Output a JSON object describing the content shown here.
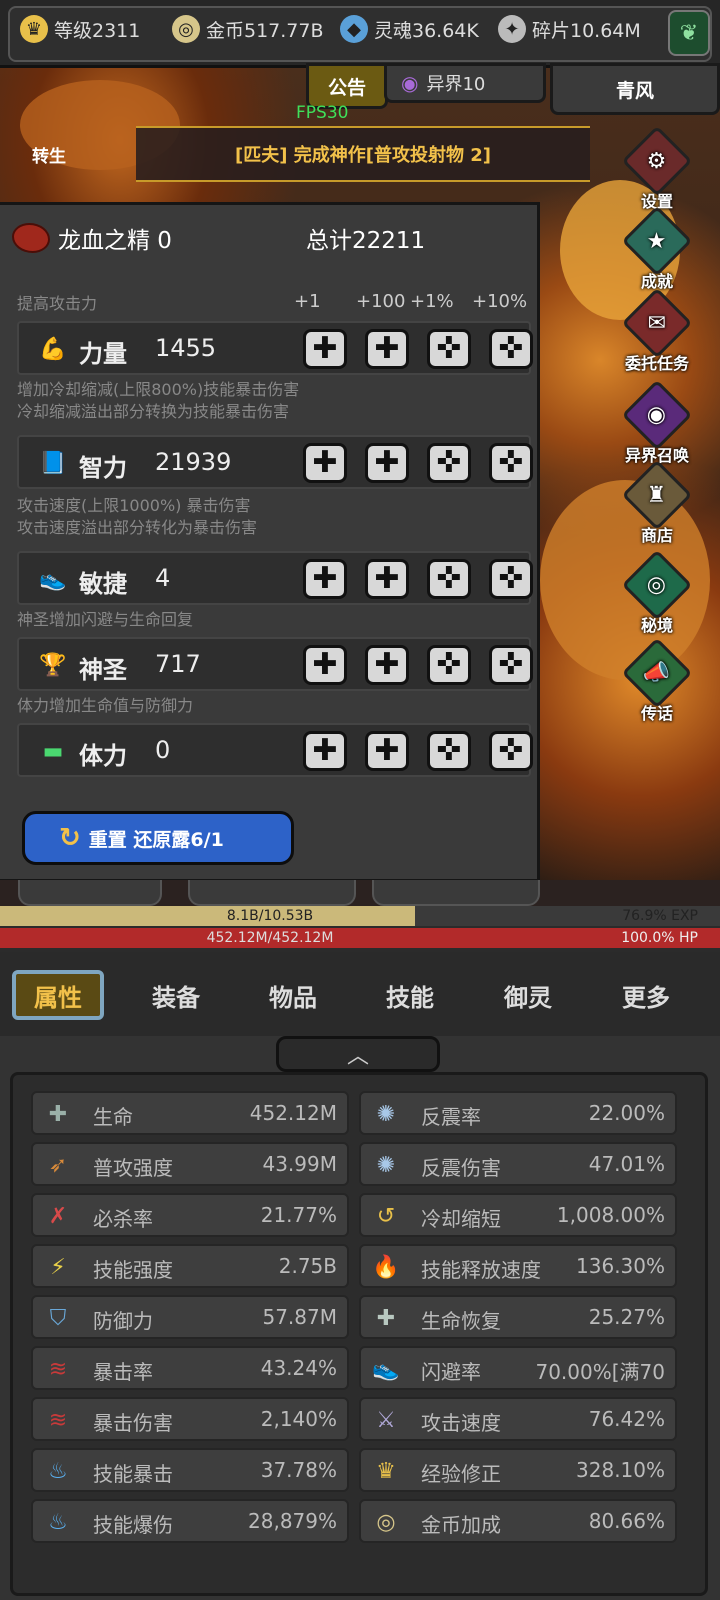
{
  "resources": [
    {
      "icon": "crown-icon",
      "label": "等级2311",
      "color": "#e8c04a",
      "glyph": "♛"
    },
    {
      "icon": "coin-icon",
      "label": "金币517.77B",
      "color": "#d6c68a",
      "glyph": "◎"
    },
    {
      "icon": "soul-icon",
      "label": "灵魂36.64K",
      "color": "#5aa0d8",
      "glyph": "◆"
    },
    {
      "icon": "shard-icon",
      "label": "碎片10.64M",
      "color": "#bbbbbb",
      "glyph": "✦"
    }
  ],
  "tabs": {
    "notice": "公告",
    "other_world": "异界10",
    "qingfeng": "青风"
  },
  "fps": "FPS30",
  "banner": "[匹夫] 完成神作[普攻投射物 2]",
  "rebirth": "转生",
  "side_menu": [
    {
      "label": "设置",
      "icon": "gear-icon",
      "glyph": "⚙",
      "bg": "#6a2a2a"
    },
    {
      "label": "成就",
      "icon": "star-icon",
      "glyph": "★",
      "bg": "#2a6a5a"
    },
    {
      "label": "委托任务",
      "icon": "letter-icon",
      "glyph": "✉",
      "bg": "#7a2a2a"
    },
    {
      "label": "异界召唤",
      "icon": "portal-icon",
      "glyph": "◉",
      "bg": "#5a2a7a"
    },
    {
      "label": "商店",
      "icon": "bag-icon",
      "glyph": "♜",
      "bg": "#6a5a3a"
    },
    {
      "label": "秘境",
      "icon": "vortex-icon",
      "glyph": "◎",
      "bg": "#1e6a4a"
    },
    {
      "label": "传话",
      "icon": "horn-icon",
      "glyph": "📣",
      "bg": "#2a6a3a"
    }
  ],
  "panel": {
    "essence_label": "龙血之精 0",
    "total": "总计22211",
    "increments": [
      "+1",
      "+100",
      "+1%",
      "+10%"
    ],
    "stats": [
      {
        "desc": [
          "提高攻击力"
        ],
        "name": "力量",
        "value": "1455",
        "icon": "muscle-icon",
        "glyph": "💪",
        "color": "#e8b08a"
      },
      {
        "desc": [
          "增加冷却缩减(上限800%)技能暴击伤害",
          "冷却缩减溢出部分转换为技能暴击伤害"
        ],
        "name": "智力",
        "value": "21939",
        "icon": "book-icon",
        "glyph": "📘",
        "color": "#4a8ad8"
      },
      {
        "desc": [
          "攻击速度(上限1000%) 暴击伤害",
          "攻击速度溢出部分转化为暴击伤害"
        ],
        "name": "敏捷",
        "value": "4",
        "icon": "winged-boot-icon",
        "glyph": "👟",
        "color": "#e8d04a"
      },
      {
        "desc": [
          "神圣增加闪避与生命回复"
        ],
        "name": "神圣",
        "value": "717",
        "icon": "trophy-icon",
        "glyph": "🏆",
        "color": "#e8c04a"
      },
      {
        "desc": [
          "体力增加生命值与防御力"
        ],
        "name": "体力",
        "value": "0",
        "icon": "bed-icon",
        "glyph": "▬",
        "color": "#4ad870"
      }
    ],
    "reset_label": "重置 还原露6/1"
  },
  "exp": {
    "text": "8.1B/10.53B",
    "percent_label": "76.9% EXP",
    "fraction": 0.769,
    "color": "#cbb97a"
  },
  "hp": {
    "text": "452.12M/452.12M",
    "percent_label": "100.0%  HP",
    "fraction": 1.0,
    "color": "#b22a2a"
  },
  "bottom_tabs": [
    "属性",
    "装备",
    "物品",
    "技能",
    "御灵",
    "更多"
  ],
  "attributes": [
    {
      "label": "生命",
      "value": "452.12M",
      "icon": "cross-icon",
      "glyph": "✚",
      "color": "#9ab0a8"
    },
    {
      "label": "反震率",
      "value": "22.00%",
      "icon": "burst-icon",
      "glyph": "✺",
      "color": "#a8c8e8"
    },
    {
      "label": "普攻强度",
      "value": "43.99M",
      "icon": "arrow-icon",
      "glyph": "➶",
      "color": "#d88a3a"
    },
    {
      "label": "反震伤害",
      "value": "47.01%",
      "icon": "burst-damage-icon",
      "glyph": "✺",
      "color": "#a8c8e8"
    },
    {
      "label": "必杀率",
      "value": "21.77%",
      "icon": "slash-icon",
      "glyph": "✗",
      "color": "#d84a4a"
    },
    {
      "label": "冷却缩短",
      "value": "1,008.00%",
      "icon": "cooldown-icon",
      "glyph": "↺",
      "color": "#e8c04a"
    },
    {
      "label": "技能强度",
      "value": "2.75B",
      "icon": "lightning-icon",
      "glyph": "⚡",
      "color": "#e8d04a"
    },
    {
      "label": "技能释放速度",
      "value": "136.30%",
      "icon": "flame-shield-icon",
      "glyph": "🔥",
      "color": "#e89a3a"
    },
    {
      "label": "防御力",
      "value": "57.87M",
      "icon": "shield-icon",
      "glyph": "⛉",
      "color": "#6aa8d8"
    },
    {
      "label": "生命恢复",
      "value": "25.27%",
      "icon": "regen-icon",
      "glyph": "✚",
      "color": "#b8c8c0"
    },
    {
      "label": "暴击率",
      "value": "43.24%",
      "icon": "claw-icon",
      "glyph": "≋",
      "color": "#c83a3a"
    },
    {
      "label": "闪避率",
      "value": "70.00%[满70",
      "icon": "boot-icon",
      "glyph": "👟",
      "color": "#e8d04a"
    },
    {
      "label": "暴击伤害",
      "value": "2,140%",
      "icon": "claw-damage-icon",
      "glyph": "≋",
      "color": "#c83a3a"
    },
    {
      "label": "攻击速度",
      "value": "76.42%",
      "icon": "sword-icon",
      "glyph": "⚔",
      "color": "#b0a8d8"
    },
    {
      "label": "技能暴击",
      "value": "37.78%",
      "icon": "blue-flame-icon",
      "glyph": "♨",
      "color": "#5ab0f0"
    },
    {
      "label": "经验修正",
      "value": "328.10%",
      "icon": "crown-icon",
      "glyph": "♛",
      "color": "#e8c04a"
    },
    {
      "label": "技能爆伤",
      "value": "28,879%",
      "icon": "blue-flame-burst-icon",
      "glyph": "♨",
      "color": "#5ab0f0"
    },
    {
      "label": "金币加成",
      "value": "80.66%",
      "icon": "coin-icon",
      "glyph": "◎",
      "color": "#d6c68a"
    }
  ]
}
